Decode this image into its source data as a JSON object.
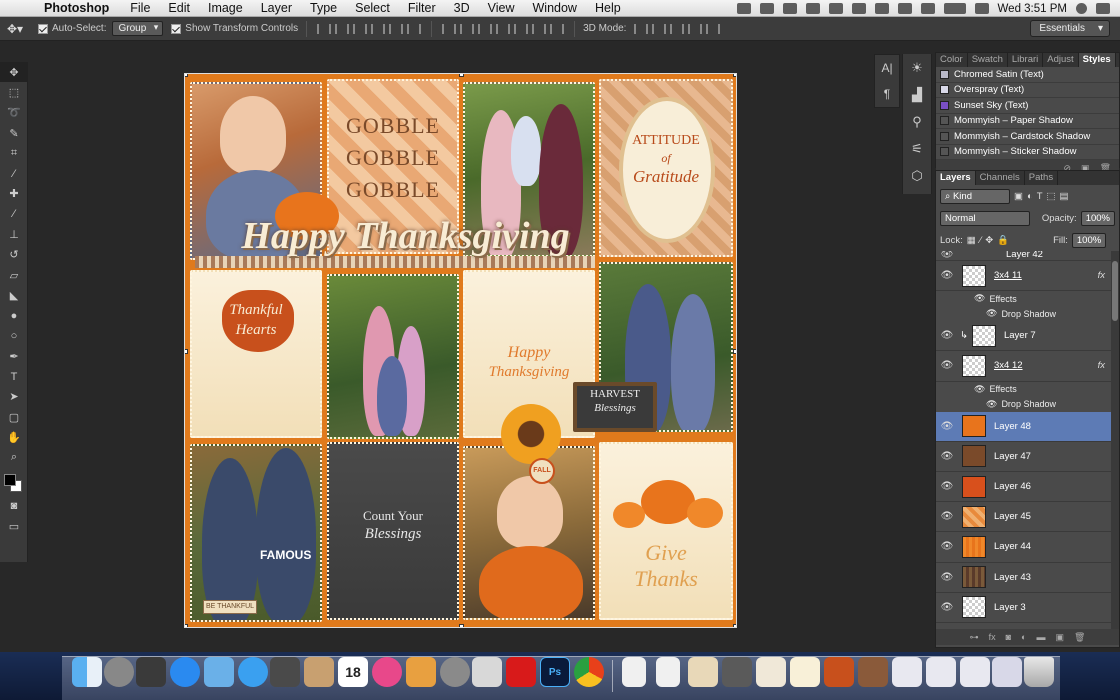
{
  "menubar": {
    "app_name": "Photoshop",
    "items": [
      "File",
      "Edit",
      "Image",
      "Layer",
      "Type",
      "Select",
      "Filter",
      "3D",
      "View",
      "Window",
      "Help"
    ],
    "clock": "Wed 3:51 PM"
  },
  "options": {
    "auto_select_label": "Auto-Select:",
    "auto_select_value": "Group",
    "transform_label": "Show Transform Controls",
    "mode_3d_label": "3D Mode:",
    "workspace": "Essentials"
  },
  "styles_panel": {
    "tabs": [
      "Color",
      "Swatch",
      "Librari",
      "Adjust",
      "Styles"
    ],
    "active_tab": "Styles",
    "items": [
      {
        "label": "Chromed Satin (Text)",
        "color": "#b8b8c8"
      },
      {
        "label": "Overspray (Text)",
        "color": "#d8d8e8"
      },
      {
        "label": "Sunset Sky (Text)",
        "color": "#7a4fc4"
      },
      {
        "label": "Mommyish – Paper Shadow",
        "color": "#555555"
      },
      {
        "label": "Mommyish – Cardstock Shadow",
        "color": "#555555"
      },
      {
        "label": "Mommyish – Sticker Shadow",
        "color": "#555555"
      }
    ]
  },
  "layers_panel": {
    "tabs": [
      "Layers",
      "Channels",
      "Paths"
    ],
    "filter_kind": "Kind",
    "blend_mode": "Normal",
    "opacity_label": "Opacity:",
    "opacity": "100%",
    "lock_label": "Lock:",
    "fill_label": "Fill:",
    "fill": "100%",
    "partial_layer": "Layer 42",
    "layers": [
      {
        "name": "3x4 11",
        "thumb": "checker",
        "fx": "fx",
        "effects": "Effects",
        "effect": "Drop Shadow",
        "linked": true
      },
      {
        "name": "Layer 7",
        "thumb": "checker",
        "clipped": true
      },
      {
        "name": "3x4 12",
        "thumb": "checker",
        "fx": "fx",
        "effects": "Effects",
        "effect": "Drop Shadow",
        "linked": true
      },
      {
        "name": "Layer 48",
        "thumb": "#e8741c",
        "selected": true
      },
      {
        "name": "Layer 47",
        "thumb": "#7a4a2a"
      },
      {
        "name": "Layer 46",
        "thumb": "#d8501c"
      },
      {
        "name": "Layer 45",
        "thumb": "#e88a3c"
      },
      {
        "name": "Layer 44",
        "thumb": "#f0882a"
      },
      {
        "name": "Layer 43",
        "thumb": "#7a5a3a"
      },
      {
        "name": "Layer 3",
        "thumb": "checker"
      }
    ]
  },
  "canvas": {
    "gobble": [
      "GOBBLE",
      "GOBBLE",
      "GOBBLE"
    ],
    "attitude": "ATTITUDE",
    "of": "of",
    "gratitude": "Gratitude",
    "happy_thanksgiving": "Happy Thanksgiving",
    "thankful": "Thankful",
    "hearts": "Hearts",
    "happy2": "Happy",
    "thanksgiving2": "Thanksgiving",
    "harvest": "HARVEST",
    "blessings": "Blessings",
    "count_your": "Count Your",
    "blessings2": "Blessings",
    "give": "Give",
    "thanks": "Thanks",
    "be_thankful": "BE THANKFUL",
    "famous": "FAMOUS",
    "fall": "FALL"
  },
  "dock": {
    "calendar_day": "18",
    "ps_label": "Ps"
  }
}
